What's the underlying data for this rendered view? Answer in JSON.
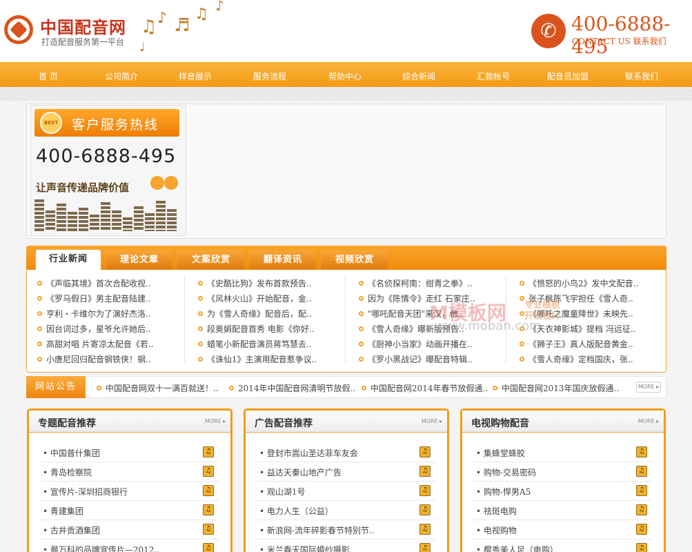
{
  "header": {
    "logo_title": "中国配音网",
    "logo_subtitle": "打造配音服务第一平台",
    "phone": "400-6888-495",
    "contact_label": "CONTACT US 联系我们"
  },
  "nav": {
    "items": [
      "首 页",
      "公司简介",
      "样音展示",
      "服务流程",
      "帮助中心",
      "综合新闻",
      "汇款帐号",
      "配音员加盟",
      "联系我们"
    ]
  },
  "banner": {
    "badge": "BEST",
    "hotline_label": "客户服务热线",
    "phone": "400-6888-495",
    "slogan": "让声音传递品牌价值"
  },
  "news": {
    "tabs": [
      "行业新闻",
      "理论文章",
      "文案欣赏",
      "翻译资讯",
      "视频欣赏"
    ],
    "columns": [
      [
        "《声临其境》首次合配收视..",
        "《罗马假日》男主配音陆建..",
        "亨利・卡维尔为了演好杰洛..",
        "因台词过多，星爷允许她后..",
        "高甜对唱 片寄凉太配音《若..",
        "小唐尼回归配音钢铁侠！钢.."
      ],
      [
        "《史酷比狗》发布首款预告..",
        "《风林火山》开始配音，金..",
        "为《雪人奇缘》配音后，配..",
        "段奥娟配音首秀 电影《你好..",
        "蜡笔小新配音演员蒋笃慧去..",
        "《诛仙1》主演用配音惹争议.."
      ],
      [
        "《名侦探柯南：绀青之拳》..",
        "因为《陈情令》走红 石家庄..",
        "\"哪吒配音天团\"来汉，他..",
        "《雪人奇缘》曝新版预告..",
        "《厨神小当家》动画开播在..",
        "《罗小黑战记》曝配音特辑.."
      ],
      [
        "《愤怒的小鸟2》发中文配音..",
        "张子枫陈飞宇担任《雪人奇..",
        "《哪吒之魔童降世》未映先..",
        "《天衣神影城》提档 冯远征..",
        "《狮子王》真人版配音黄金..",
        "《雪人奇缘》定档国庆，张.."
      ]
    ],
    "watermark": "M模板网",
    "watermark_url": "www.moban.com",
    "watermark_tag": "专业模板开发设计"
  },
  "notice": {
    "label": "网站公告",
    "items": [
      "中国配音网双十一满百就送！..",
      "2014年中国配音网清明节放假..",
      "中国配音网2014年春节放假通..",
      "中国配音网2013年国庆放假通.."
    ],
    "more": "MORE"
  },
  "panels": [
    {
      "title": "专题配音推荐",
      "more": "MORE",
      "items": [
        "中国普什集团",
        "青岛检察院",
        "宣传片-深圳招商银行",
        "青建集团",
        "古井贡酒集团",
        "最万科的品牌宣传片—2012.."
      ]
    },
    {
      "title": "广告配音推荐",
      "more": "MORE",
      "items": [
        "登封市嵩山圣达菲车友会",
        "益达天秦山地产广告",
        "观山湖1号",
        "电力人生（公益）",
        "新浪网-流年碎影春节特别节..",
        "米兰春天国际婚纱摄影"
      ]
    },
    {
      "title": "电视购物配音",
      "more": "MORE",
      "items": [
        "集蜂堂蜂胶",
        "购物-交易密码",
        "购物-悍男A5",
        "祛斑电购",
        "电视购物",
        "樱秀美人足（电购）"
      ]
    }
  ],
  "icons": {
    "phone": "phone-icon",
    "play": "headphone-icon"
  },
  "colors": {
    "accent": "#f29a12",
    "brand_red": "#d9541c"
  }
}
